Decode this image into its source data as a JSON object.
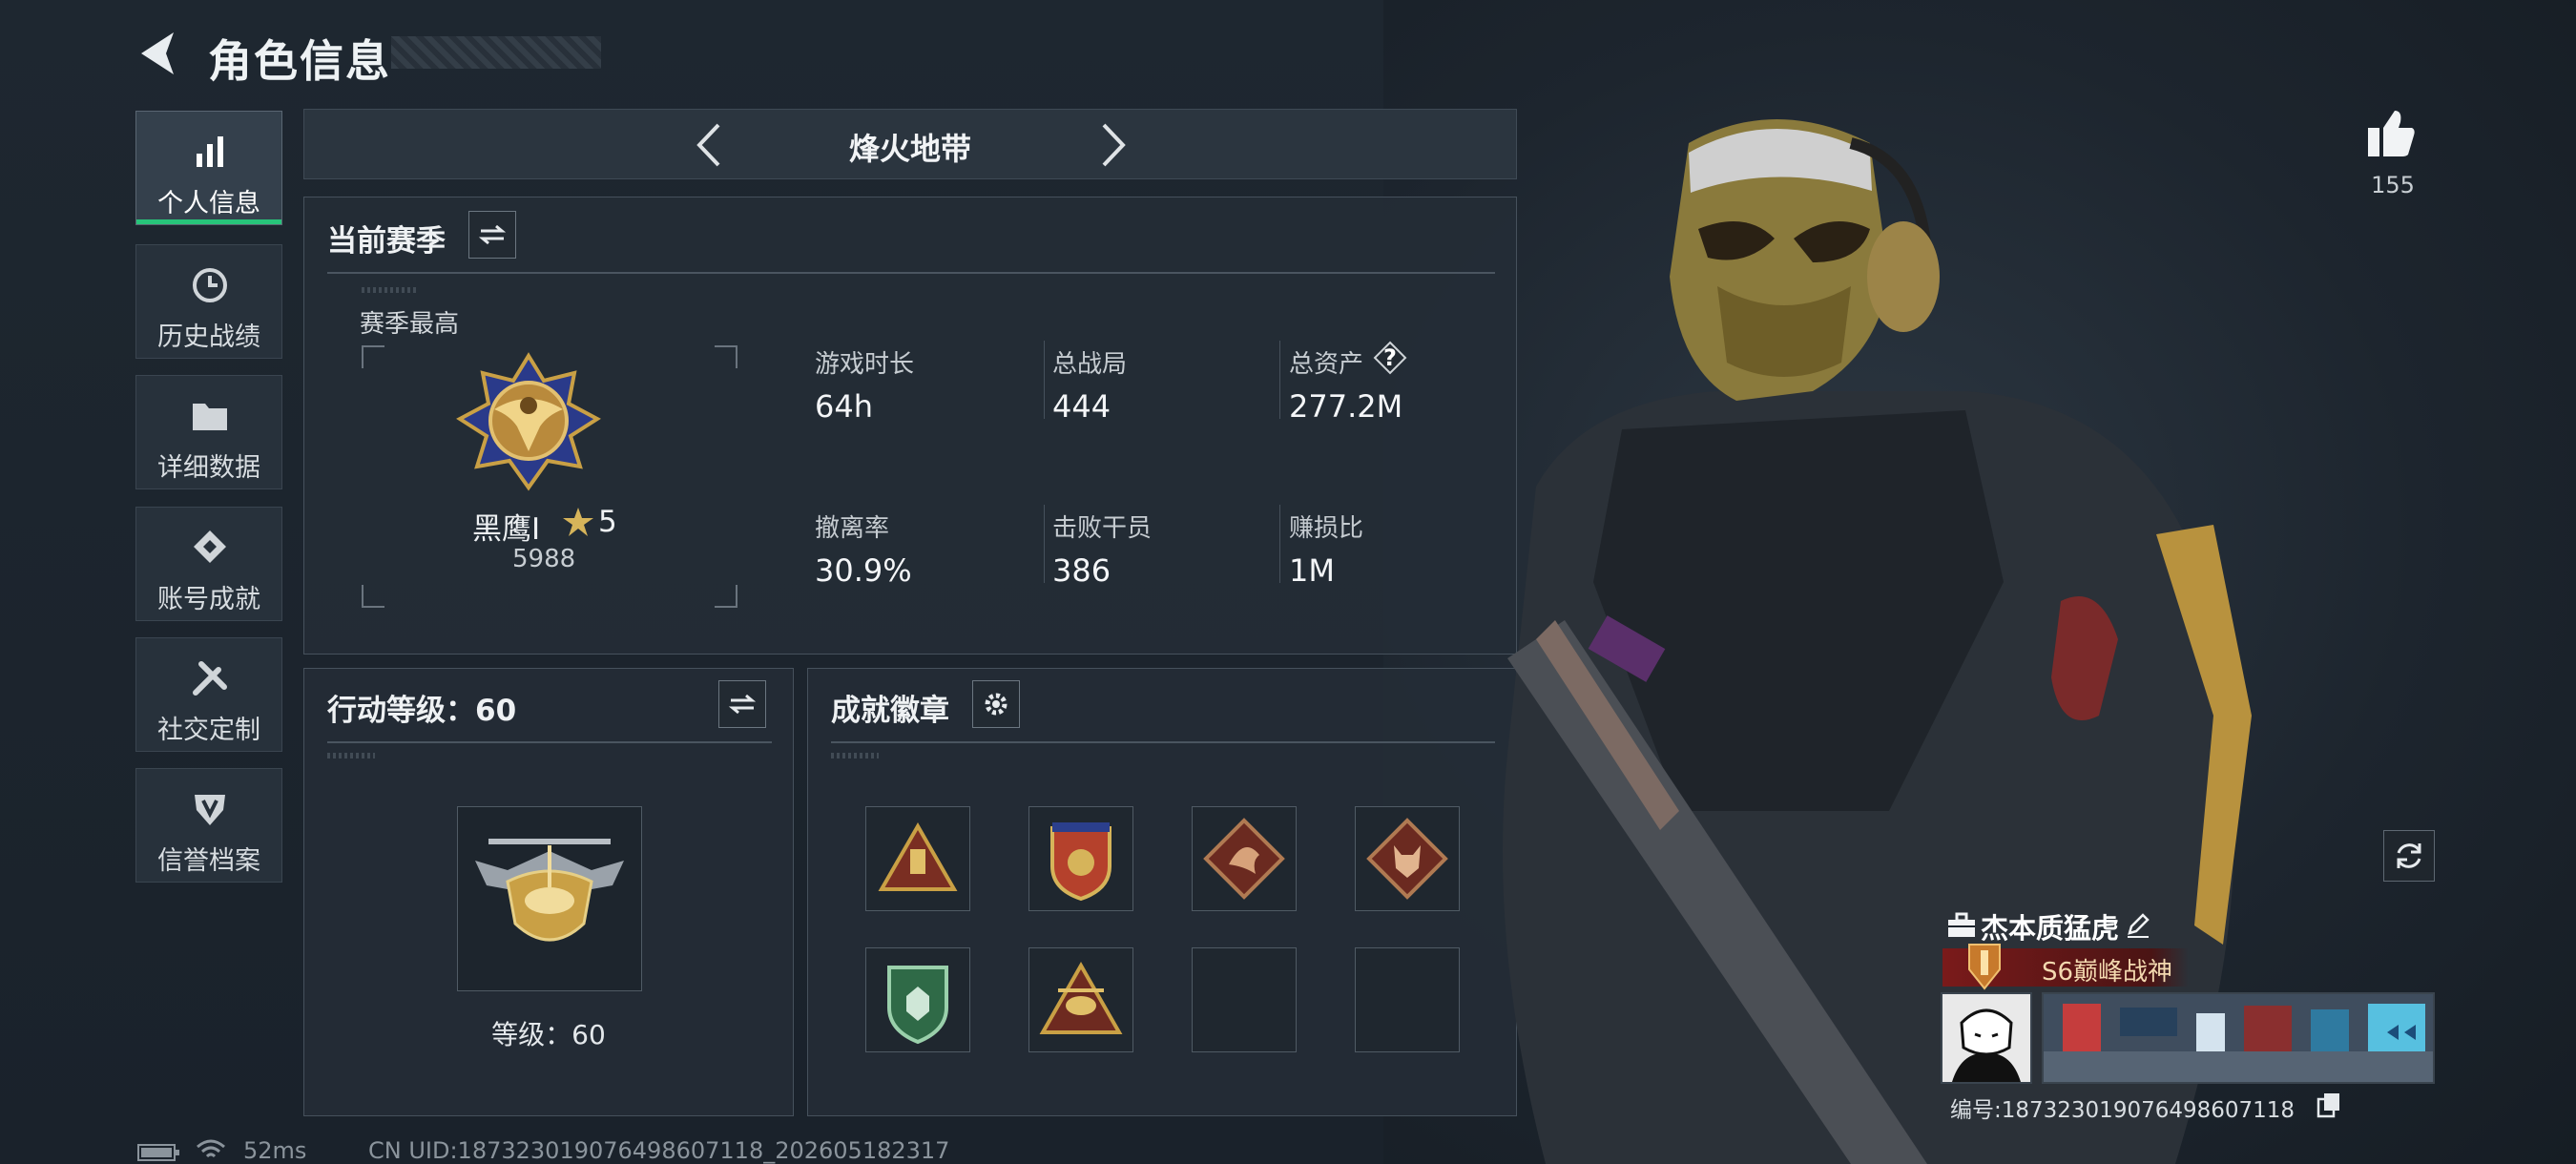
{
  "header": {
    "title": "角色信息"
  },
  "sidebar": {
    "items": [
      {
        "label": "个人信息",
        "icon": "bar-chart-icon",
        "active": true
      },
      {
        "label": "历史战绩",
        "icon": "history-icon",
        "active": false
      },
      {
        "label": "详细数据",
        "icon": "folder-icon",
        "active": false
      },
      {
        "label": "账号成就",
        "icon": "achievement-icon",
        "active": false
      },
      {
        "label": "社交定制",
        "icon": "tools-icon",
        "active": false
      },
      {
        "label": "信誉档案",
        "icon": "shield-badge-icon",
        "active": false
      }
    ]
  },
  "mode_selector": {
    "name": "烽火地带"
  },
  "season": {
    "title": "当前赛季",
    "best_label": "赛季最高",
    "rank_name": "黑鹰I",
    "rank_stars": "5",
    "rank_score": "5988",
    "stats": [
      {
        "label": "游戏时长",
        "value": "64h"
      },
      {
        "label": "总战局",
        "value": "444"
      },
      {
        "label": "总资产",
        "value": "277.2M",
        "help": "?"
      },
      {
        "label": "撤离率",
        "value": "30.9%"
      },
      {
        "label": "击败干员",
        "value": "386"
      },
      {
        "label": "赚损比",
        "value": "1M"
      }
    ]
  },
  "operation": {
    "title": "行动等级：60",
    "level_text": "等级：60"
  },
  "achievements": {
    "title": "成就徽章",
    "badges_filled": 6,
    "slots": 8
  },
  "likes": {
    "count": "155"
  },
  "player": {
    "name": "杰本质猛虎",
    "title_badge": "S6巅峰战神",
    "id_text": "编号:1873230190764986071​18"
  },
  "status": {
    "ping": "52ms",
    "uid": "CN UID:187323019076498607118_202605182317"
  },
  "colors": {
    "accent_green": "#27c47a",
    "gold": "#c9a045",
    "panel": "#242d36"
  }
}
